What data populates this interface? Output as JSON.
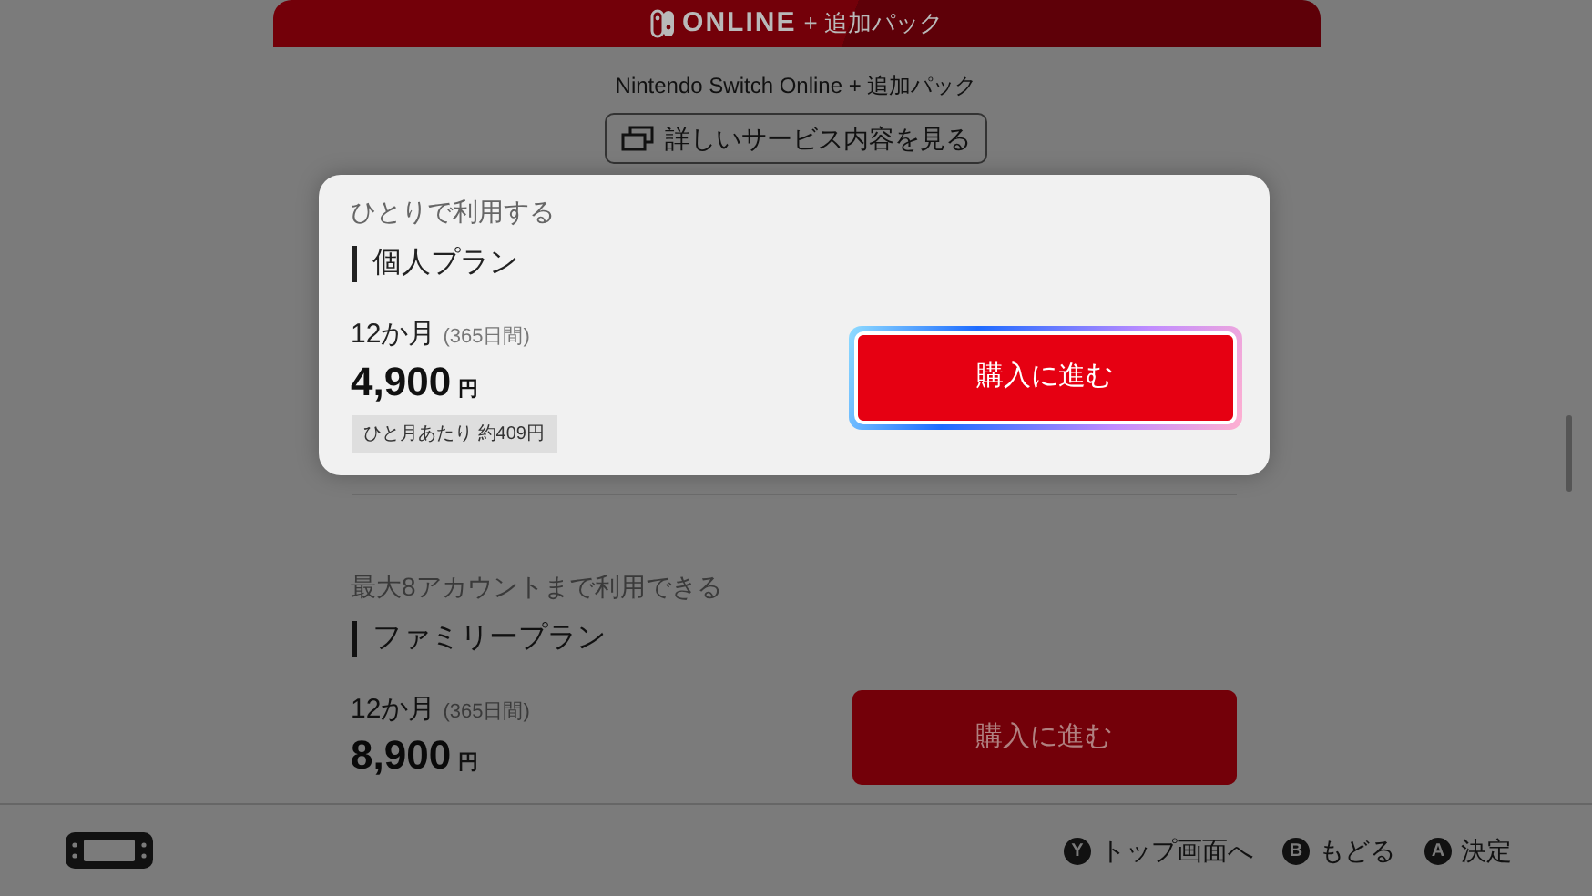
{
  "header": {
    "logo_text": "ONLINE",
    "suffix": "+ 追加パック"
  },
  "subtitle": "Nintendo Switch Online + 追加パック",
  "details_button": "詳しいサービス内容を見る",
  "plans": [
    {
      "caption": "ひとりで利用する",
      "name": "個人プラン",
      "duration": "12か月",
      "duration_note": "(365日間)",
      "price": "4,900",
      "currency": "円",
      "per_month": "ひと月あたり 約409円",
      "button": "購入に進む",
      "selected": true
    },
    {
      "caption": "最大8アカウントまで利用できる",
      "name": "ファミリープラン",
      "duration": "12か月",
      "duration_note": "(365日間)",
      "price": "8,900",
      "currency": "円",
      "button": "購入に進む",
      "selected": false
    }
  ],
  "footer": {
    "hints": [
      {
        "key": "Y",
        "label": "トップ画面へ"
      },
      {
        "key": "B",
        "label": "もどる"
      },
      {
        "key": "A",
        "label": "決定"
      }
    ]
  }
}
